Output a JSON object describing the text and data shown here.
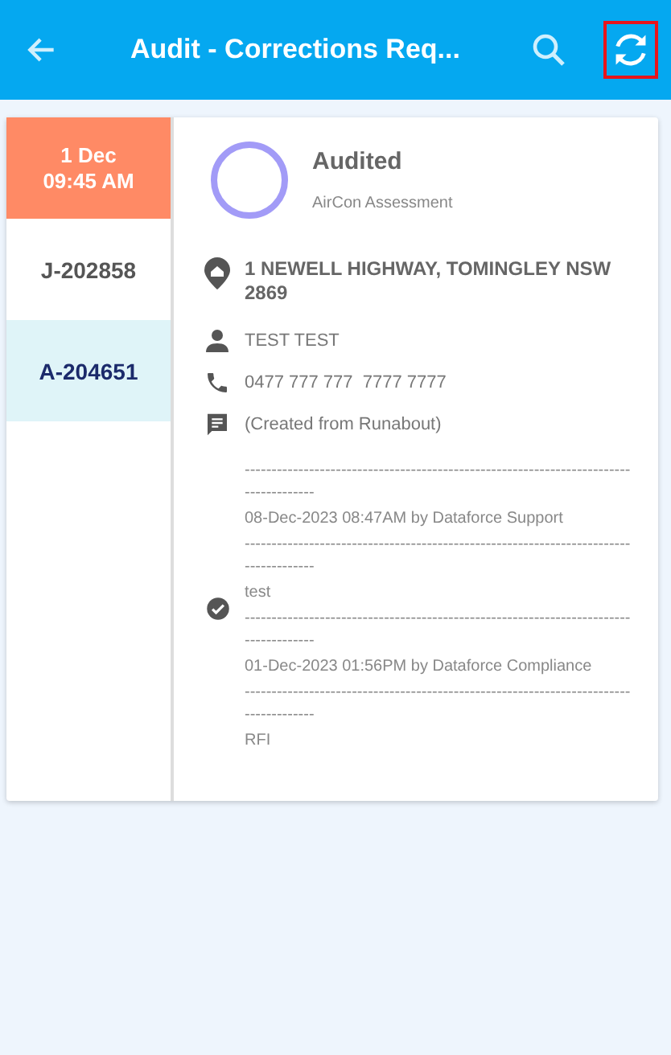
{
  "app_bar": {
    "title": "Audit - Corrections Req...",
    "refresh_highlighted": true
  },
  "jobs": [
    {
      "kind": "date",
      "lines": [
        "1 Dec",
        "09:45 AM"
      ],
      "selected": false
    },
    {
      "kind": "id",
      "lines": [
        "J-202858"
      ],
      "selected": false
    },
    {
      "kind": "id",
      "lines": [
        "A-204651"
      ],
      "selected": true
    }
  ],
  "detail": {
    "status": "Audited",
    "type": "AirCon Assessment",
    "rows": [
      {
        "kind": "address",
        "text": "1 NEWELL HIGHWAY, TOMINGLEY NSW 2869"
      },
      {
        "kind": "person",
        "text": "TEST TEST"
      },
      {
        "kind": "phone",
        "text": "0477 777 777  7777 7777"
      },
      {
        "kind": "note",
        "text": "(Created from Runabout)"
      }
    ],
    "history": {
      "done": true,
      "lines": [
        "-------------------------------------------------------------------------------------",
        "08-Dec-2023 08:47AM by Dataforce Support",
        "-------------------------------------------------------------------------------------",
        "test",
        "-------------------------------------------------------------------------------------",
        "01-Dec-2023 01:56PM by Dataforce Compliance",
        "-------------------------------------------------------------------------------------",
        "RFI"
      ]
    }
  }
}
